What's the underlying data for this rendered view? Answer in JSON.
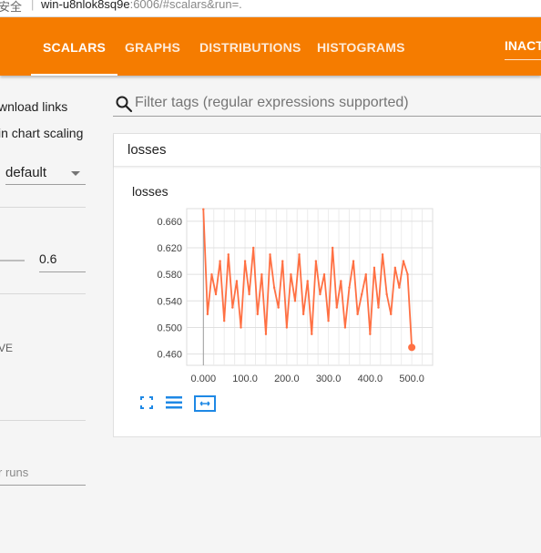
{
  "browser": {
    "security_text": "安全",
    "url_host": "win-u8nlok8sq9e",
    "url_rest": ":6006/#scalars&run=."
  },
  "nav": {
    "tabs": [
      {
        "label": "SCALARS",
        "active": true
      },
      {
        "label": "GRAPHS",
        "active": false
      },
      {
        "label": "DISTRIBUTIONS",
        "active": false
      },
      {
        "label": "HISTOGRAMS",
        "active": false
      }
    ],
    "inactive_label": "INACTIVE"
  },
  "sidebar": {
    "download_links": "wnload links",
    "chart_scaling": "in chart scaling",
    "tooltip_sorting_value": "default",
    "smoothing_value": "0.6",
    "horizontal_axis_fragment": "VE",
    "runs_placeholder": "r runs"
  },
  "filter": {
    "placeholder": "Filter tags (regular expressions supported)"
  },
  "card": {
    "header": "losses",
    "chart_title": "losses"
  },
  "colors": {
    "accent": "#f57c00",
    "series": "#ff7043"
  },
  "icons": [
    "search-icon",
    "fullscreen-icon",
    "toggle-log-scale-icon",
    "fit-domain-icon"
  ],
  "chart_data": {
    "type": "line",
    "title": "losses",
    "x_ticks": [
      "0.000",
      "100.0",
      "200.0",
      "300.0",
      "400.0",
      "500.0"
    ],
    "y_ticks": [
      "0.660",
      "0.620",
      "0.580",
      "0.540",
      "0.500",
      "0.460"
    ],
    "xlim": [
      -40,
      550
    ],
    "ylim": [
      0.443,
      0.679
    ],
    "series": [
      {
        "name": "",
        "x": [
          0,
          10,
          20,
          30,
          40,
          50,
          60,
          70,
          80,
          90,
          100,
          110,
          120,
          130,
          140,
          150,
          160,
          170,
          180,
          190,
          200,
          210,
          220,
          230,
          240,
          250,
          260,
          270,
          280,
          290,
          300,
          310,
          320,
          330,
          340,
          350,
          360,
          370,
          380,
          390,
          400,
          410,
          420,
          430,
          440,
          450,
          460,
          470,
          480,
          490,
          500
        ],
        "values": [
          0.678,
          0.52,
          0.58,
          0.55,
          0.6,
          0.51,
          0.61,
          0.53,
          0.57,
          0.5,
          0.6,
          0.55,
          0.62,
          0.52,
          0.58,
          0.49,
          0.61,
          0.56,
          0.53,
          0.6,
          0.5,
          0.58,
          0.54,
          0.61,
          0.52,
          0.57,
          0.49,
          0.6,
          0.55,
          0.58,
          0.51,
          0.62,
          0.53,
          0.57,
          0.5,
          0.56,
          0.6,
          0.52,
          0.55,
          0.58,
          0.49,
          0.59,
          0.53,
          0.61,
          0.55,
          0.52,
          0.59,
          0.56,
          0.6,
          0.58,
          0.47
        ]
      }
    ]
  }
}
